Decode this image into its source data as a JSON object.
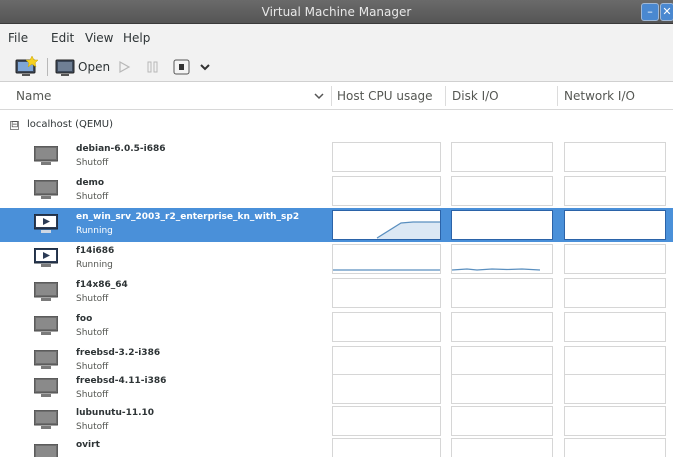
{
  "window": {
    "title": "Virtual Machine Manager",
    "buttons": [
      "minimize-icon",
      "close-icon"
    ]
  },
  "menu": [
    {
      "label": "File"
    },
    {
      "label": "Edit"
    },
    {
      "label": "View"
    },
    {
      "label": "Help"
    }
  ],
  "toolbar": {
    "new_vm_icon": "new-vm-icon",
    "open_label": "Open",
    "open_icon": "monitor-icon",
    "run_icon": "play-icon",
    "pause_icon": "pause-icon",
    "shutdown_icon": "shutdown-icon",
    "dropdown_icon": "chevron-down-icon"
  },
  "columns": {
    "name": "Name",
    "cpu": "Host CPU usage",
    "disk": "Disk I/O",
    "network": "Network I/O"
  },
  "connection": {
    "label": "localhost (QEMU)",
    "expander": "⊟"
  },
  "vms": [
    {
      "name": "debian-6.0.5-i686",
      "status": "Shutoff",
      "selected": false
    },
    {
      "name": "demo",
      "status": "Shutoff",
      "selected": false
    },
    {
      "name": "en_win_srv_2003_r2_enterprise_kn_with_sp2",
      "status": "Running",
      "selected": true
    },
    {
      "name": "f14i686",
      "status": "Running",
      "selected": false
    },
    {
      "name": "f14x86_64",
      "status": "Shutoff",
      "selected": false
    },
    {
      "name": "foo",
      "status": "Shutoff",
      "selected": false
    },
    {
      "name": "freebsd-3.2-i386",
      "status": "Shutoff",
      "selected": false
    },
    {
      "name": "freebsd-4.11-i386",
      "status": "Shutoff",
      "selected": false
    },
    {
      "name": "lubunutu-11.10",
      "status": "Shutoff",
      "selected": false
    },
    {
      "name": "ovirt",
      "status": "",
      "selected": false
    }
  ],
  "colors": {
    "selection": "#4a90d9",
    "graph_line": "#5a8fbf",
    "graph_fill": "#cfe0f0"
  }
}
